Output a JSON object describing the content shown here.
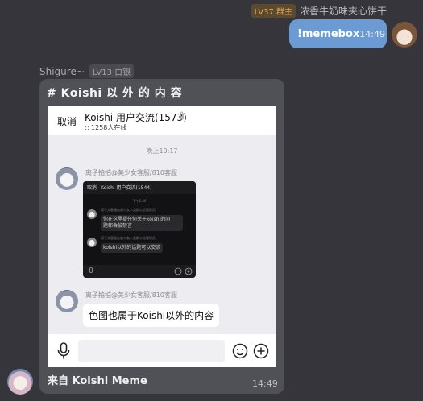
{
  "top_message": {
    "level_badge": "LV37 群主",
    "sender": "浓香牛奶味夹心饼干",
    "text": "!memebox",
    "time": "14:49"
  },
  "other_message": {
    "sender": "Shigure~",
    "level_badge": "LV13 白银",
    "card_title": "# Koishi 以 外 的 内 容",
    "footer": "来自 Koishi Meme",
    "time": "14:49"
  },
  "screenshot": {
    "cancel": "取消",
    "group_title": "Koishi 用户交流(1573)",
    "online": "1258人在线",
    "timestamp": "晚上10:17",
    "sender1": "离子拍拍@美少女客服/810客服",
    "sender2": "离子拍拍@美少女客服/810客服",
    "reply_text": "色图也属于Koishi以外的内容",
    "inner": {
      "cancel": "取消",
      "group_title": "Koishi 用户交流(1544)",
      "time": "下午2:46",
      "sender1": "离子文客服@美少女人类群公告管理员",
      "bubble1_line1": "你在这里提任何关于koishi的问",
      "bubble1_line2": "题都会被禁言",
      "sender2": "离子文客服@美少女人类群公告管理员",
      "bubble2": "koishi以外的话题可以交流"
    }
  },
  "icons": {
    "mic": "microphone-icon",
    "emoji": "emoji-icon",
    "plus": "plus-icon",
    "clip": "paperclip-icon"
  }
}
